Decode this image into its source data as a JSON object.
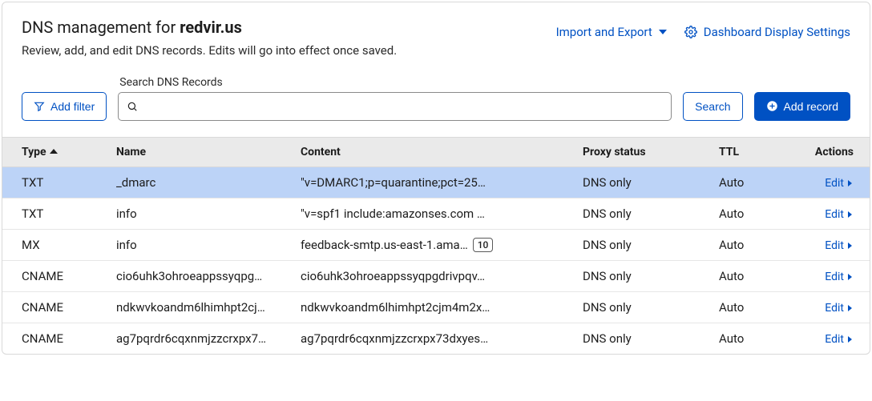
{
  "header": {
    "title_prefix": "DNS management for ",
    "domain": "redvir.us",
    "subtitle": "Review, add, and edit DNS records. Edits will go into effect once saved.",
    "import_export": "Import and Export",
    "display_settings": "Dashboard Display Settings"
  },
  "toolbar": {
    "add_filter": "Add filter",
    "search_label": "Search DNS Records",
    "search_value": "",
    "search_btn": "Search",
    "add_record": "Add record"
  },
  "columns": {
    "type": "Type",
    "name": "Name",
    "content": "Content",
    "proxy": "Proxy status",
    "ttl": "TTL",
    "actions": "Actions"
  },
  "edit_label": "Edit",
  "records": [
    {
      "type": "TXT",
      "name": "_dmarc",
      "content": "\"v=DMARC1;p=quarantine;pct=25…",
      "badge": null,
      "proxy": "DNS only",
      "ttl": "Auto",
      "selected": true
    },
    {
      "type": "TXT",
      "name": "info",
      "content": "\"v=spf1 include:amazonses.com ~…",
      "badge": null,
      "proxy": "DNS only",
      "ttl": "Auto",
      "selected": false
    },
    {
      "type": "MX",
      "name": "info",
      "content": "feedback-smtp.us-east-1.ama…",
      "badge": "10",
      "proxy": "DNS only",
      "ttl": "Auto",
      "selected": false
    },
    {
      "type": "CNAME",
      "name": "cio6uhk3ohroeappssyqpg…",
      "content": "cio6uhk3ohroeappssyqpgdrivpqv…",
      "badge": null,
      "proxy": "DNS only",
      "ttl": "Auto",
      "selected": false
    },
    {
      "type": "CNAME",
      "name": "ndkwvkoandm6lhimhpt2cj…",
      "content": "ndkwvkoandm6lhimhpt2cjm4m2x…",
      "badge": null,
      "proxy": "DNS only",
      "ttl": "Auto",
      "selected": false
    },
    {
      "type": "CNAME",
      "name": "ag7pqrdr6cqxnmjzzcrxpx7…",
      "content": "ag7pqrdr6cqxnmjzzcrxpx73dxyes…",
      "badge": null,
      "proxy": "DNS only",
      "ttl": "Auto",
      "selected": false
    }
  ]
}
